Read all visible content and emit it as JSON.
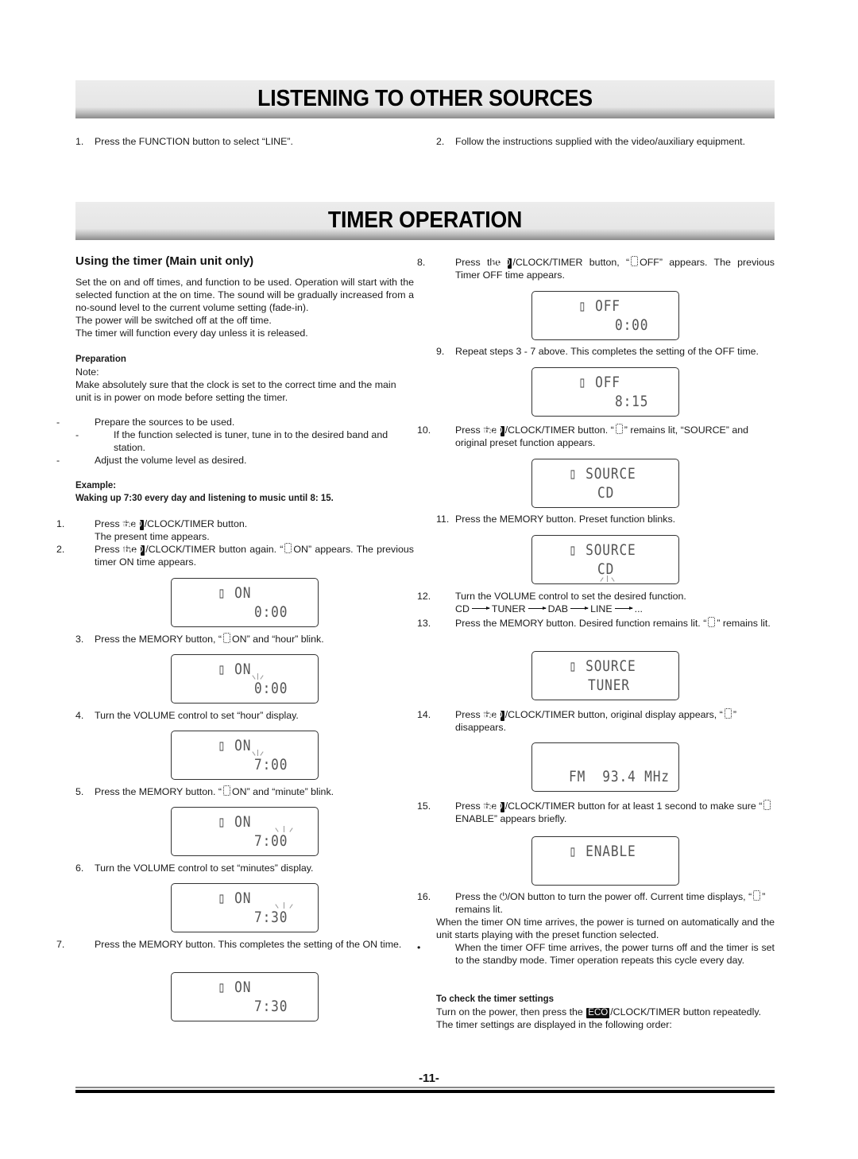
{
  "section1": {
    "title": "LISTENING TO OTHER SOURCES",
    "steps": [
      {
        "num": "1.",
        "text": "Press the FUNCTION button to select “LINE”."
      },
      {
        "num": "2.",
        "text": "Follow the instructions supplied with the video/auxiliary equipment."
      }
    ]
  },
  "section2": {
    "title": "TIMER OPERATION",
    "subtitle": "Using the timer (Main unit only)",
    "intro": [
      "Set the on and off times, and function to be used. Operation will start with the selected function at the on time. The sound will be gradually increased from a no-sound level to the current volume setting (fade-in).",
      "The power will be switched off at the off time.",
      "The timer will function every day unless it is released."
    ],
    "preparation": {
      "heading": "Preparation",
      "note_label": "Note:",
      "note": "Make absolutely sure that the clock is set to the correct time and the main unit is in power on mode before setting the timer.",
      "items": [
        "Prepare the sources to be used.",
        "If the function selected is tuner, tune in to the desired band and station.",
        "Adjust the volume level as desired."
      ]
    },
    "example": {
      "heading": "Example:",
      "text": "Waking up 7:30 every day and listening to music until 8: 15."
    },
    "eco_label": "ECO",
    "steps": {
      "s1": {
        "num": "1.",
        "pre": "Press the",
        "post": "/CLOCK/TIMER button.",
        "line2": "The present time appears."
      },
      "s2": {
        "num": "2.",
        "pre": "Press the",
        "post": "/CLOCK/TIMER button again. “",
        "post2": "ON” appears. The previous timer ON time appears."
      },
      "s3": {
        "num": "3.",
        "pre": "Press the MEMORY button, “",
        "post": "ON” and “hour” blink."
      },
      "s4": {
        "num": "4.",
        "text": "Turn the VOLUME control to set “hour” display."
      },
      "s5": {
        "num": "5.",
        "pre": "Press the MEMORY button. “",
        "post": "ON” and “minute” blink."
      },
      "s6": {
        "num": "6.",
        "text": "Turn the VOLUME control to set “minutes” display."
      },
      "s7": {
        "num": "7.",
        "text": "Press the MEMORY button. This completes the setting of the ON time."
      },
      "s8": {
        "num": "8.",
        "pre": "Press the",
        "post": "/CLOCK/TIMER button, “",
        "post2": "OFF” appears. The previous Timer OFF time appears."
      },
      "s9": {
        "num": "9.",
        "text": "Repeat steps 3 - 7 above. This completes the setting of the OFF time."
      },
      "s10": {
        "num": "10.",
        "pre": "Press the",
        "post": "/CLOCK/TIMER button. “",
        "post2": "” remains lit, “SOURCE” and original preset function appears."
      },
      "s11": {
        "num": "11.",
        "text": "Press the MEMORY button. Preset function blinks."
      },
      "s12": {
        "num": "12.",
        "text": "Turn the VOLUME control to set the desired function.",
        "sequence": [
          "CD",
          "TUNER",
          "DAB",
          "LINE",
          "..."
        ]
      },
      "s13": {
        "num": "13.",
        "pre": "Press the MEMORY button. Desired function remains lit. “",
        "post": "” remains lit."
      },
      "s14": {
        "num": "14.",
        "pre": "Press the",
        "post": "/CLOCK/TIMER button, original display appears, “",
        "post2": "” disappears."
      },
      "s15": {
        "num": "15.",
        "pre": "Press the",
        "post": "/CLOCK/TIMER button for at least 1 second to make sure “",
        "post2": "ENABLE” appears briefly."
      },
      "s16": {
        "num": "16.",
        "pre": "Press the ⏻/ON button to turn the power off. Current time displays, “",
        "post": "” remains lit."
      }
    },
    "after": {
      "para": "When the timer ON time arrives, the power is turned on automatically and the unit starts playing with the preset function selected.",
      "bullet": "When the timer OFF time arrives, the power turns off and the timer is set to the standby mode. Timer operation repeats this cycle every day."
    },
    "check": {
      "heading": "To check the timer settings",
      "pre": "Turn on the power, then press the",
      "post": "/CLOCK/TIMER button repeatedly.",
      "line2": "The timer settings are displayed in the following order:"
    }
  },
  "displays": {
    "d1": {
      "l1": "▯ ON",
      "l2": "0:00"
    },
    "d2": {
      "l1": "▯ ON",
      "l2": "0:00"
    },
    "d3": {
      "l1": "▯ ON",
      "l2": "7:00"
    },
    "d4": {
      "l1": "▯ ON",
      "l2": "7:00"
    },
    "d5": {
      "l1": "▯ ON",
      "l2": "7:30"
    },
    "d6": {
      "l1": "▯ ON",
      "l2": "7:30"
    },
    "d7": {
      "l1": "▯ OFF",
      "l2": "0:00"
    },
    "d8": {
      "l1": "▯ OFF",
      "l2": "8:15"
    },
    "d9": {
      "l1": "▯ SOURCE",
      "l2": "CD"
    },
    "d10": {
      "l1": "▯ SOURCE",
      "l2": "CD"
    },
    "d11": {
      "l1": "▯ SOURCE",
      "l2": "TUNER"
    },
    "d12": {
      "l1": "",
      "l2": "FM  93.4 MHz"
    },
    "d13": {
      "l1": "▯ ENABLE",
      "l2": ""
    }
  },
  "footer": {
    "page_number": "-11-"
  }
}
